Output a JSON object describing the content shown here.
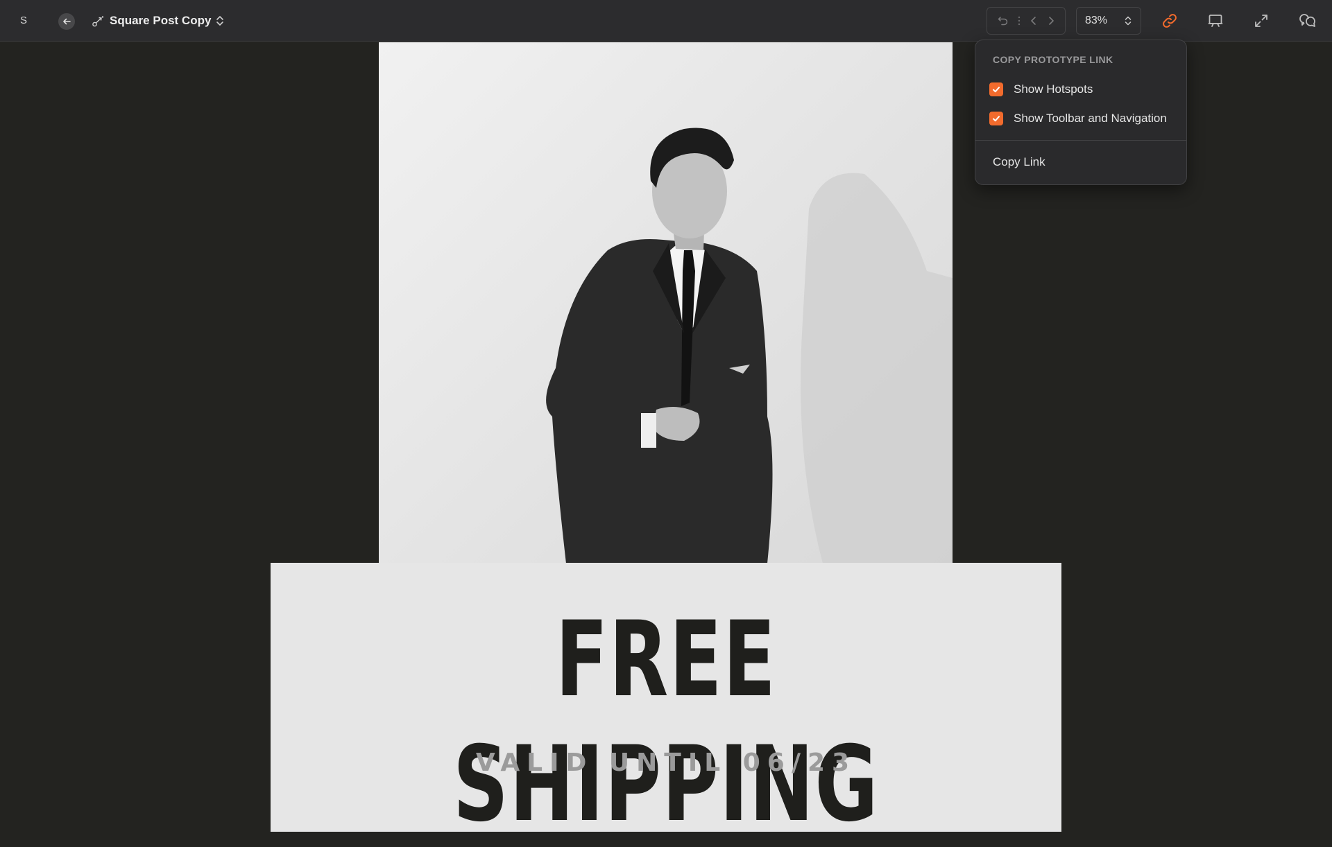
{
  "toolbar": {
    "avatar_initial": "S",
    "doc_title": "Square Post Copy",
    "zoom_value": "83%",
    "accent_color": "#f26b2d"
  },
  "popover": {
    "heading": "COPY PROTOTYPE LINK",
    "options": [
      {
        "label": "Show Hotspots",
        "checked": true
      },
      {
        "label": "Show Toolbar and Navigation",
        "checked": true
      }
    ],
    "copy_link_label": "Copy Link"
  },
  "canvas": {
    "headline": "FREE SHIPPING",
    "subline": "VALID UNTIL 06/23"
  },
  "icons": [
    "back-arrow-icon",
    "prototype-link-icon",
    "chevron-updown-icon",
    "undo-icon",
    "more-vertical-icon",
    "chevron-left-icon",
    "chevron-right-icon",
    "link-icon",
    "presentation-icon",
    "fullscreen-icon",
    "comments-icon",
    "checkmark-icon"
  ]
}
